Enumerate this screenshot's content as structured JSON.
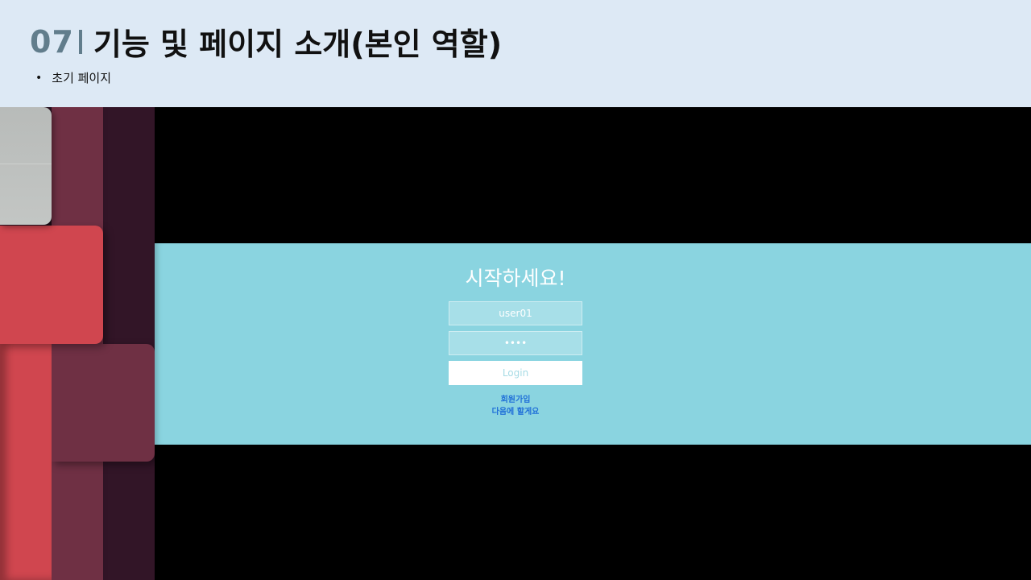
{
  "header": {
    "number": "07",
    "title": "기능 및 페이지 소개(본인 역할)",
    "bullet": "초기 페이지"
  },
  "login": {
    "title": "시작하세요!",
    "username_value": "user01",
    "password_value": "••••",
    "login_label": "Login",
    "signup_link": "회원가입",
    "later_link": "다음에 할게요"
  },
  "colors": {
    "header_bg": "#dde9f5",
    "number_accent": "#617d8c",
    "panel_bg": "#8ad4e0",
    "link": "#1f6fd8",
    "deco_red": "#d0464f",
    "deco_maroon": "#6f3044",
    "deco_dark": "#321527",
    "deco_gray": "#bdc0be"
  }
}
